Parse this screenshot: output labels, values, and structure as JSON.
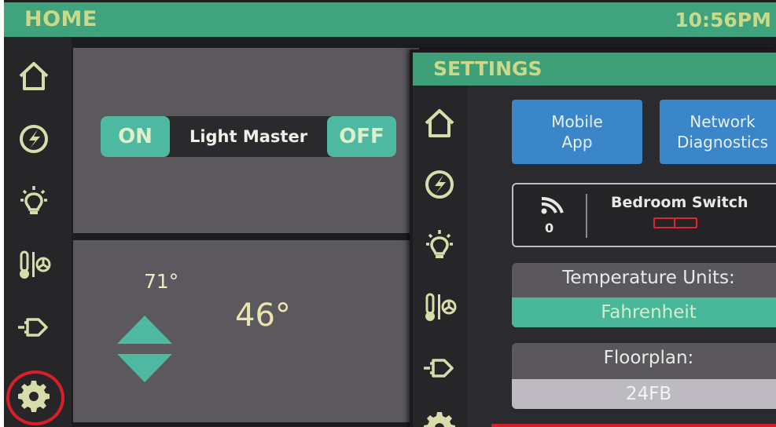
{
  "home": {
    "title": "HOME",
    "clock": "10:56PM"
  },
  "nav": {
    "items": [
      {
        "icon": "home-icon"
      },
      {
        "icon": "energy-icon"
      },
      {
        "icon": "lightbulb-icon"
      },
      {
        "icon": "thermostat-fan-icon"
      },
      {
        "icon": "plug-icon"
      },
      {
        "icon": "gear-icon"
      }
    ]
  },
  "lights": {
    "on_label": "ON",
    "name": "Light Master",
    "off_label": "OFF"
  },
  "thermostat": {
    "setpoint": "71°",
    "current": "46°"
  },
  "settings": {
    "title": "SETTINGS",
    "mobile_app": "Mobile\nApp",
    "network_diagnostics": "Network\nDiagnostics",
    "device": {
      "signal_count": "0",
      "name": "Bedroom Switch"
    },
    "temperature_units": {
      "label": "Temperature Units:",
      "value": "Fahrenheit"
    },
    "floorplan": {
      "label": "Floorplan:",
      "value": "24FB"
    }
  },
  "colors": {
    "accent_green": "#3fa47e",
    "teal_button": "#4fb8a1",
    "blue_button": "#3b86c9",
    "highlight_red": "#d71f2b"
  }
}
